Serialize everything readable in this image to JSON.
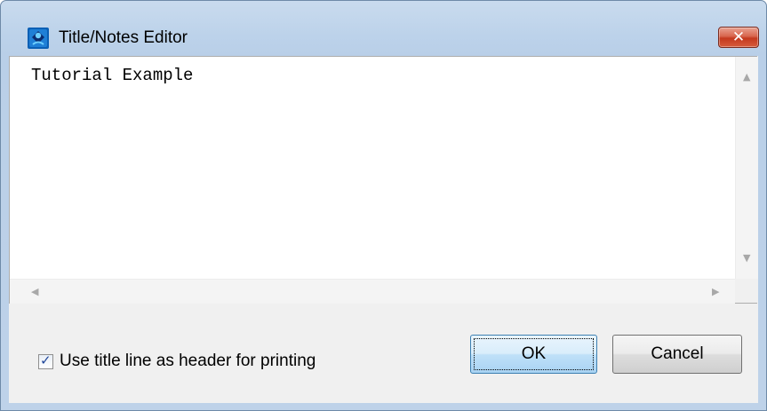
{
  "window": {
    "title": "Title/Notes Editor",
    "close_glyph": "✕",
    "app_icon": "title-notes-app-icon"
  },
  "editor": {
    "text": "Tutorial Example",
    "scroll_up": "▲",
    "scroll_down": "▼",
    "scroll_left": "◀",
    "scroll_right": "▶"
  },
  "footer": {
    "checkbox_checked": true,
    "checkbox_glyph": "✓",
    "checkbox_label": "Use title line as header for printing",
    "ok_label": "OK",
    "cancel_label": "Cancel"
  },
  "colors": {
    "accent": "#3c7fb1",
    "close_red": "#c4391e",
    "window_frame": "#bcd2ea"
  }
}
